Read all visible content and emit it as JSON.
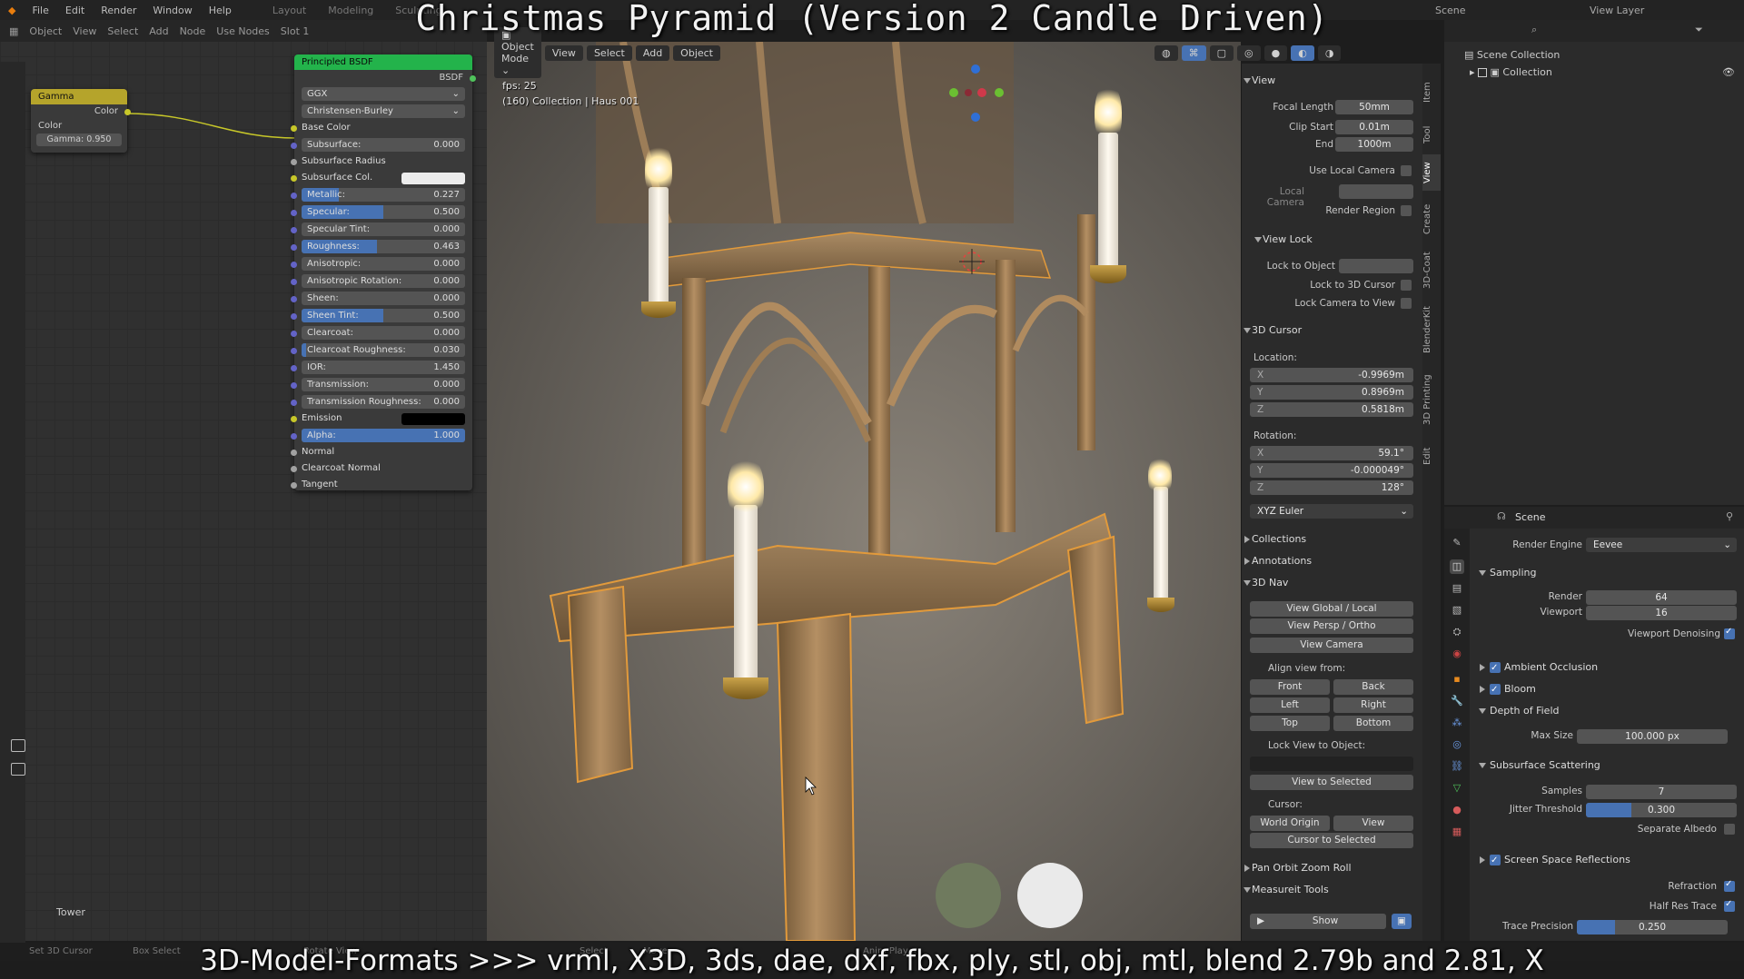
{
  "title": "Christmas Pyramid (Version 2 Candle Driven)",
  "caption": "3D-Model-Formats >>> vrml, X3D, 3ds, dae, dxf, fbx, ply, stl, obj, mtl, blend 2.79b and 2.81, X",
  "topbar": {
    "menus": [
      "File",
      "Edit",
      "Render",
      "Window",
      "Help"
    ],
    "workspaces": [
      "Layout",
      "Modeling",
      "Sculpting"
    ],
    "scene": "Scene",
    "view_layer": "View Layer"
  },
  "node_editor": {
    "header": [
      "Object",
      "View",
      "Select",
      "Add",
      "Node",
      "Use Nodes",
      "Slot 1"
    ],
    "gamma_node": {
      "title": "Gamma",
      "out": "Color",
      "in": "Color",
      "gamma_label": "Gamma",
      "gamma_value": "0.950"
    },
    "bsdf_node": {
      "title": "Principled BSDF",
      "output": "BSDF",
      "dist": "GGX",
      "sss_method": "Christensen-Burley",
      "rows": [
        {
          "label": "Base Color",
          "value": "",
          "fill": 0
        },
        {
          "label": "Subsurface:",
          "value": "0.000",
          "fill": 0
        },
        {
          "label": "Subsurface Radius",
          "value": "",
          "fill": 0
        },
        {
          "label": "Subsurface Col.",
          "value": "",
          "fill": 0,
          "swatch": "#ececec"
        },
        {
          "label": "Metallic:",
          "value": "0.227",
          "fill": 0.227
        },
        {
          "label": "Specular:",
          "value": "0.500",
          "fill": 0.5
        },
        {
          "label": "Specular Tint:",
          "value": "0.000",
          "fill": 0
        },
        {
          "label": "Roughness:",
          "value": "0.463",
          "fill": 0.463
        },
        {
          "label": "Anisotropic:",
          "value": "0.000",
          "fill": 0
        },
        {
          "label": "Anisotropic Rotation:",
          "value": "0.000",
          "fill": 0
        },
        {
          "label": "Sheen:",
          "value": "0.000",
          "fill": 0
        },
        {
          "label": "Sheen Tint:",
          "value": "0.500",
          "fill": 0.5
        },
        {
          "label": "Clearcoat:",
          "value": "0.000",
          "fill": 0
        },
        {
          "label": "Clearcoat Roughness:",
          "value": "0.030",
          "fill": 0.03
        },
        {
          "label": "IOR:",
          "value": "1.450",
          "fill": 0
        },
        {
          "label": "Transmission:",
          "value": "0.000",
          "fill": 0
        },
        {
          "label": "Transmission Roughness:",
          "value": "0.000",
          "fill": 0
        },
        {
          "label": "Emission",
          "value": "",
          "fill": 0,
          "swatch": "#000000"
        },
        {
          "label": "Alpha:",
          "value": "1.000",
          "fill": 1
        },
        {
          "label": "Normal",
          "value": "",
          "fill": 0
        },
        {
          "label": "Clearcoat Normal",
          "value": "",
          "fill": 0
        },
        {
          "label": "Tangent",
          "value": "",
          "fill": 0
        }
      ]
    },
    "tower_label": "Tower"
  },
  "viewport": {
    "mode": "Object Mode",
    "menus": [
      "View",
      "Select",
      "Add",
      "Object"
    ],
    "fps": "fps: 25",
    "collection_info": "(160) Collection | Haus 001"
  },
  "npanel": {
    "tabs": [
      "Item",
      "Tool",
      "View",
      "Create",
      "3D-Coat",
      "BlenderKit",
      "3D Printing",
      "Edit"
    ],
    "view_section": "View",
    "focal_length_label": "Focal Length",
    "focal_length": "50mm",
    "clip_start_label": "Clip Start",
    "clip_start": "0.01m",
    "clip_end_label": "End",
    "clip_end": "1000m",
    "use_local_camera": "Use Local Camera",
    "local_camera": "Local Camera",
    "render_region": "Render Region",
    "view_lock": "View Lock",
    "lock_to_object": "Lock to Object",
    "lock_to_cursor": "Lock to 3D Cursor",
    "lock_camera": "Lock Camera to View",
    "cursor_section": "3D Cursor",
    "location_label": "Location:",
    "loc_x": "-0.9969m",
    "loc_y": "0.8969m",
    "loc_z": "0.5818m",
    "rotation_label": "Rotation:",
    "rot_x": "59.1°",
    "rot_y": "-0.000049°",
    "rot_z": "128°",
    "rot_mode": "XYZ Euler",
    "collections": "Collections",
    "annotations": "Annotations",
    "nav_3d": "3D Nav",
    "view_global_local": "View Global / Local",
    "view_persp_ortho": "View Persp / Ortho",
    "view_camera": "View Camera",
    "align_view_from": "Align view from:",
    "front": "Front",
    "back": "Back",
    "left": "Left",
    "right": "Right",
    "top": "Top",
    "bottom": "Bottom",
    "lock_view_to_object": "Lock View to Object:",
    "view_to_selected": "View to Selected",
    "cursor_label": "Cursor:",
    "world_origin": "World Origin",
    "view_btn": "View",
    "cursor_to_selected": "Cursor to Selected",
    "pan_orbit": "Pan Orbit Zoom Roll",
    "measureit": "Measureit Tools",
    "show": "Show"
  },
  "outliner": {
    "scene_collection": "Scene Collection",
    "collection": "Collection"
  },
  "properties": {
    "scene_label": "Scene",
    "render_engine_label": "Render Engine",
    "render_engine": "Eevee",
    "sampling": "Sampling",
    "render_label": "Render",
    "render_val": "64",
    "viewport_label": "Viewport",
    "viewport_val": "16",
    "viewport_denoising": "Viewport Denoising",
    "ambient_occlusion": "Ambient Occlusion",
    "bloom": "Bloom",
    "dof": "Depth of Field",
    "max_size_label": "Max Size",
    "max_size": "100.000 px",
    "sss": "Subsurface Scattering",
    "samples_label": "Samples",
    "samples": "7",
    "jitter_label": "Jitter Threshold",
    "jitter": "0.300",
    "jitter_fill": 0.3,
    "separate_albedo": "Separate Albedo",
    "ssr": "Screen Space Reflections",
    "refraction": "Refraction",
    "half_res": "Half Res Trace",
    "trace_precision_label": "Trace Precision",
    "trace_precision": "0.250",
    "trace_fill": 0.25
  },
  "statusbar": {
    "left": [
      "Set 3D Cursor",
      "Box Select",
      "Rotate View",
      "Select",
      "Move",
      "Call Menu"
    ],
    "anim_player": "Anim Player"
  }
}
